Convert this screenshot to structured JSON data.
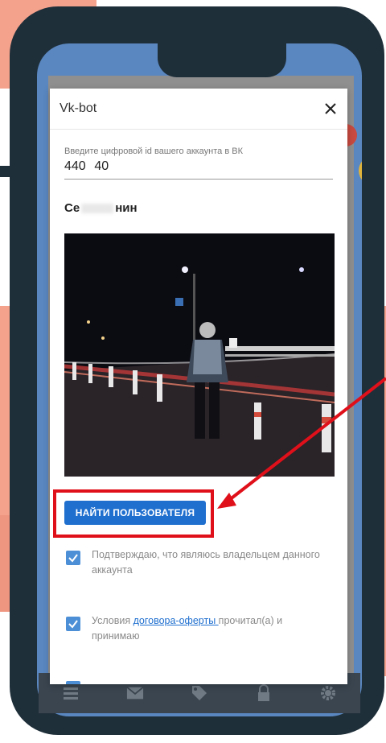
{
  "dialog": {
    "title": "Vk-bot",
    "field_label": "Введите цифровой id вашего аккаунта в ВК",
    "field_value": "440        40",
    "user_name_prefix": "Се",
    "user_name_suffix": "нин",
    "find_button": "НАЙТИ ПОЛЬЗОВАТЕЛЯ",
    "checks": [
      {
        "text": "Подтверждаю, что являюсь владельцем данного аккаунта"
      },
      {
        "text_before": "Условия ",
        "link": "договора-оферты ",
        "text_after": "прочитал(а) и принимаю"
      }
    ]
  },
  "tabbar": {
    "icons": [
      "list-icon",
      "mail-icon",
      "tag-icon",
      "lock-icon",
      "gear-icon"
    ]
  },
  "colors": {
    "accent": "#1f6fcf",
    "highlight": "#e0101a",
    "checkbox": "#4d8fd6"
  }
}
